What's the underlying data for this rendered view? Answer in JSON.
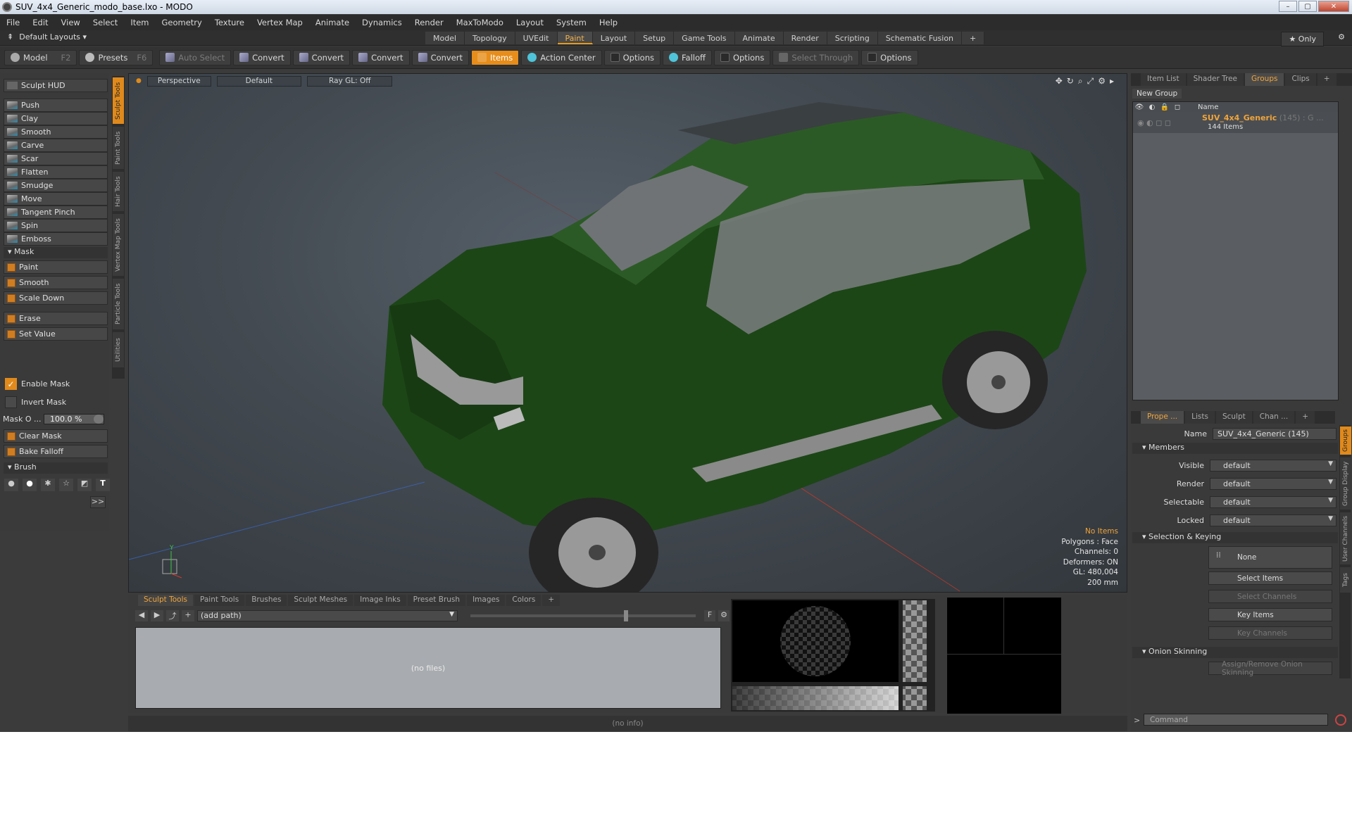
{
  "window": {
    "title": "SUV_4x4_Generic_modo_base.lxo - MODO",
    "controls": [
      "–",
      "▢",
      "✕"
    ]
  },
  "menu": [
    "File",
    "Edit",
    "View",
    "Select",
    "Item",
    "Geometry",
    "Texture",
    "Vertex Map",
    "Animate",
    "Dynamics",
    "Render",
    "MaxToModo",
    "Layout",
    "System",
    "Help"
  ],
  "layoutbar": {
    "layouts": "Default Layouts ▾",
    "tabs": [
      "Model",
      "Topology",
      "UVEdit",
      "Paint",
      "Layout",
      "Setup",
      "Game Tools",
      "Animate",
      "Render",
      "Scripting",
      "Schematic Fusion",
      "+"
    ],
    "active_tab": "Paint",
    "only": "★ Only"
  },
  "toolbar": {
    "model": "Model",
    "model_key": "F2",
    "presets": "Presets",
    "presets_key": "F6",
    "auto_select": "Auto Select",
    "convert": "Convert",
    "items": "Items",
    "options": "Options",
    "action_center": "Action Center",
    "falloff": "Falloff",
    "select_through": "Select Through"
  },
  "left": {
    "hud": "Sculpt HUD",
    "tools": [
      "Push",
      "Clay",
      "Smooth",
      "Carve",
      "Scar",
      "Flatten",
      "Smudge",
      "Move",
      "Tangent Pinch",
      "Spin",
      "Emboss"
    ],
    "mask_section": "Mask",
    "mask_tools": [
      "Paint",
      "Smooth",
      "Scale Down"
    ],
    "erase": "Erase",
    "set_value": "Set Value",
    "enable_mask": "Enable Mask",
    "invert_mask": "Invert Mask",
    "mask_opacity_label": "Mask O ...",
    "mask_opacity_value": "100.0 %",
    "clear_mask": "Clear Mask",
    "bake_falloff": "Bake Falloff",
    "brush_section": "Brush",
    "expand": ">>",
    "vtabs": [
      "Sculpt Tools",
      "Paint Tools",
      "Hair Tools",
      "Vertex Map Tools",
      "Particle Tools",
      "Utilities"
    ]
  },
  "viewport": {
    "view": "Perspective",
    "shading": "Default",
    "raygl": "Ray GL: Off",
    "stats": {
      "items": "No Items",
      "polygons": "Polygons : Face",
      "channels": "Channels: 0",
      "deformers": "Deformers: ON",
      "gl": "GL: 480,004",
      "scale": "200 mm"
    }
  },
  "right": {
    "top_tabs": [
      "Item List",
      "Shader Tree",
      "Groups",
      "Clips",
      "+"
    ],
    "active_top": "Groups",
    "new_group": "New Group",
    "col_name": "Name",
    "group_name": "SUV_4x4_Generic",
    "group_count": "(145) : G ...",
    "group_items": "144 Items",
    "prop_tabs": [
      "Prope ...",
      "Lists",
      "Sculpt",
      "Chan ...",
      "+"
    ],
    "name_label": "Name",
    "name_value": "SUV_4x4_Generic (145)",
    "members": "Members",
    "visible_label": "Visible",
    "render_label": "Render",
    "selectable_label": "Selectable",
    "locked_label": "Locked",
    "default_value": "default",
    "sel_keying": "Selection & Keying",
    "none": "None",
    "select_items": "Select Items",
    "select_channels": "Select Channels",
    "key_items": "Key Items",
    "key_channels": "Key Channels",
    "onion": "Onion Skinning",
    "assign_onion": "Assign/Remove Onion Skinning",
    "vtabs": [
      "Groups",
      "Group Display",
      "User Channels",
      "Tags"
    ],
    "command": "Command"
  },
  "bottom": {
    "tabs": [
      "Sculpt Tools",
      "Paint Tools",
      "Brushes",
      "Sculpt Meshes",
      "Image Inks",
      "Preset Brush",
      "Images",
      "Colors",
      "+"
    ],
    "active": "Sculpt Tools",
    "path": "(add path)",
    "no_files": "(no files)",
    "F": "F"
  },
  "status": "(no info)"
}
